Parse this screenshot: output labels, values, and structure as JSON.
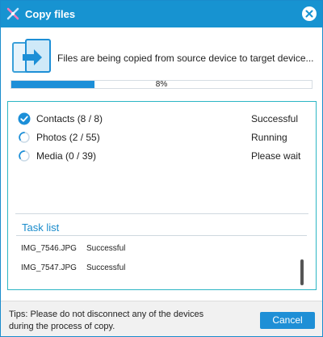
{
  "window": {
    "title": "Copy files"
  },
  "header": {
    "status_text": "Files are being copied from source device to target device...",
    "progress": {
      "percent_label": "8%",
      "value": 0.08
    }
  },
  "tasks": [
    {
      "label": "Contacts (8 / 8)",
      "status": "Successful",
      "state": "done"
    },
    {
      "label": "Photos (2 / 55)",
      "status": "Running",
      "state": "running"
    },
    {
      "label": "Media (0 / 39)",
      "status": "Please wait",
      "state": "waiting"
    }
  ],
  "task_list": {
    "title": "Task list",
    "entries": [
      {
        "file": "IMG_7546.JPG",
        "status": "Successful"
      },
      {
        "file": "IMG_7547.JPG",
        "status": "Successful"
      }
    ]
  },
  "footer": {
    "tips_line1": "Tips: Please do not disconnect any of the devices",
    "tips_line2": "during the process of copy.",
    "cancel_label": "Cancel"
  },
  "colors": {
    "accent": "#1793d1",
    "panel_border": "#2cb6c4",
    "progress": "#1c8fd8"
  },
  "icons": {
    "app": "app-logo-icon",
    "close": "close-icon",
    "copy": "copy-files-icon",
    "done": "check-circle-icon",
    "running": "spinner-icon",
    "waiting": "spinner-icon"
  }
}
